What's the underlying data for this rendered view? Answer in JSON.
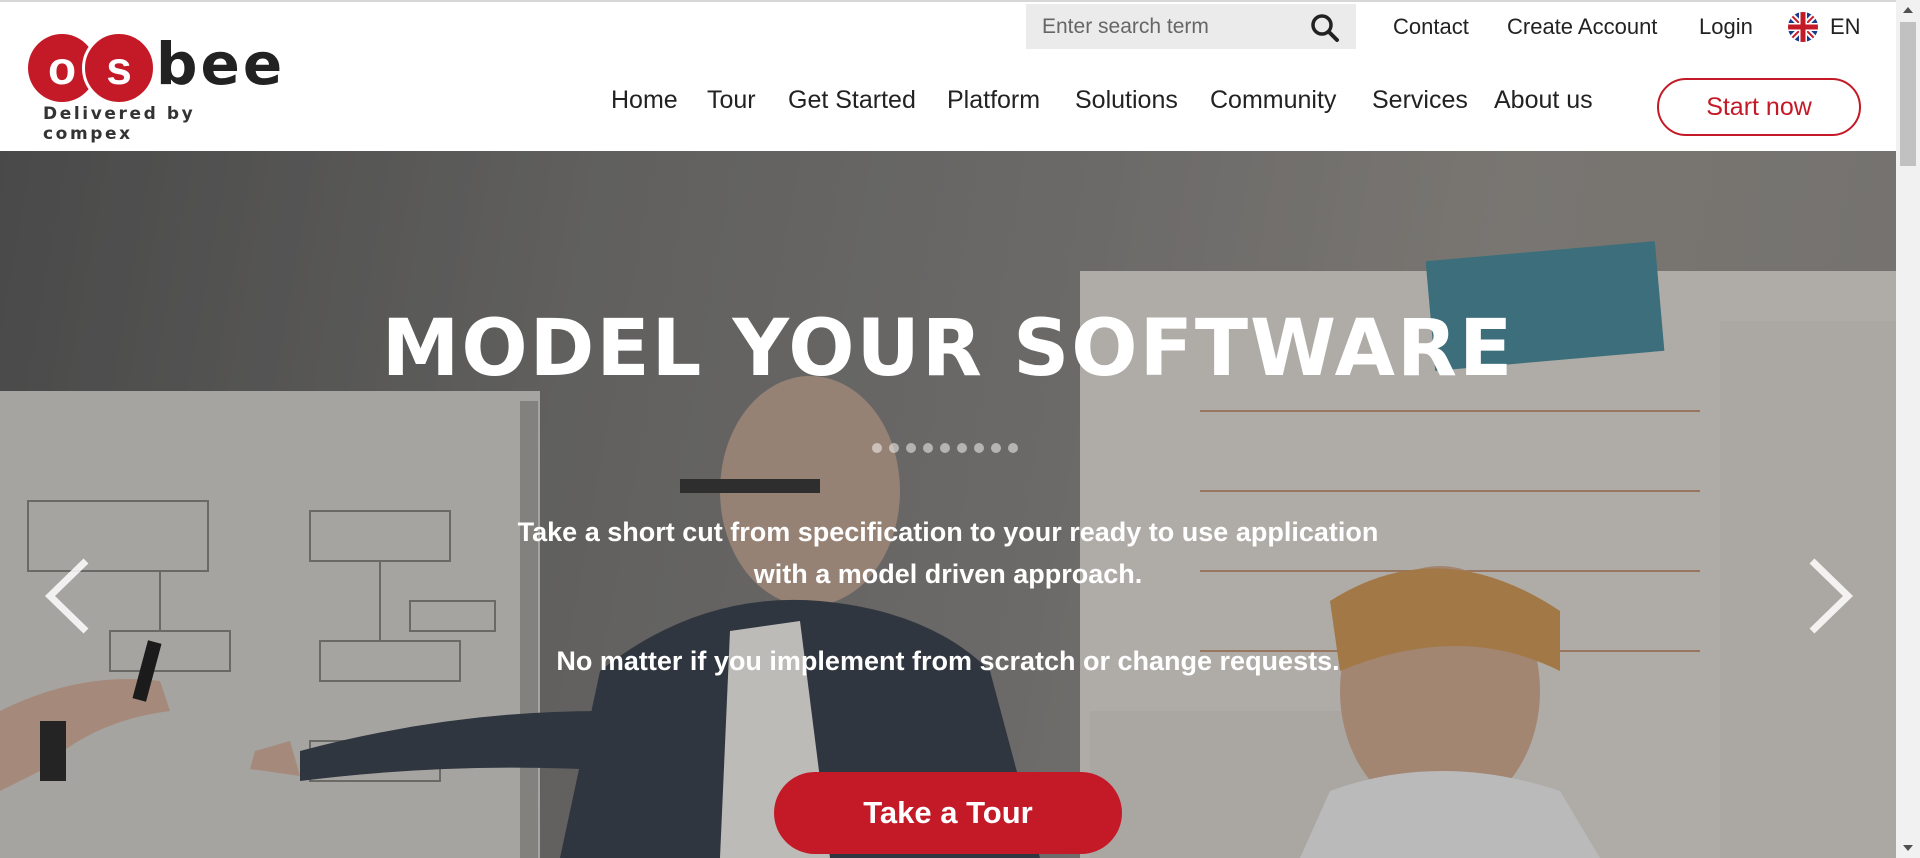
{
  "brand": {
    "logo_letters": [
      "o",
      "s"
    ],
    "logo_word": "bee",
    "tagline": "Delivered by compex",
    "accent_color": "#c41a27"
  },
  "search": {
    "placeholder": "Enter search term",
    "icon": "search-icon"
  },
  "top_links": {
    "contact": "Contact",
    "create_account": "Create Account",
    "login": "Login"
  },
  "language": {
    "code": "EN",
    "flag": "uk-flag-icon"
  },
  "main_nav": [
    "Home",
    "Tour",
    "Get Started",
    "Platform",
    "Solutions",
    "Community",
    "Services",
    "About us"
  ],
  "cta": {
    "start_label": "Start now"
  },
  "hero": {
    "title": "MODEL YOUR SOFTWARE",
    "line1": "Take a short cut from specification to your ready to use application",
    "line2": "with a model driven approach.",
    "line3": "No matter if you implement from scratch or change requests.",
    "button_label": "Take a Tour",
    "slide_count": 9,
    "prev_icon": "chevron-left-icon",
    "next_icon": "chevron-right-icon"
  }
}
